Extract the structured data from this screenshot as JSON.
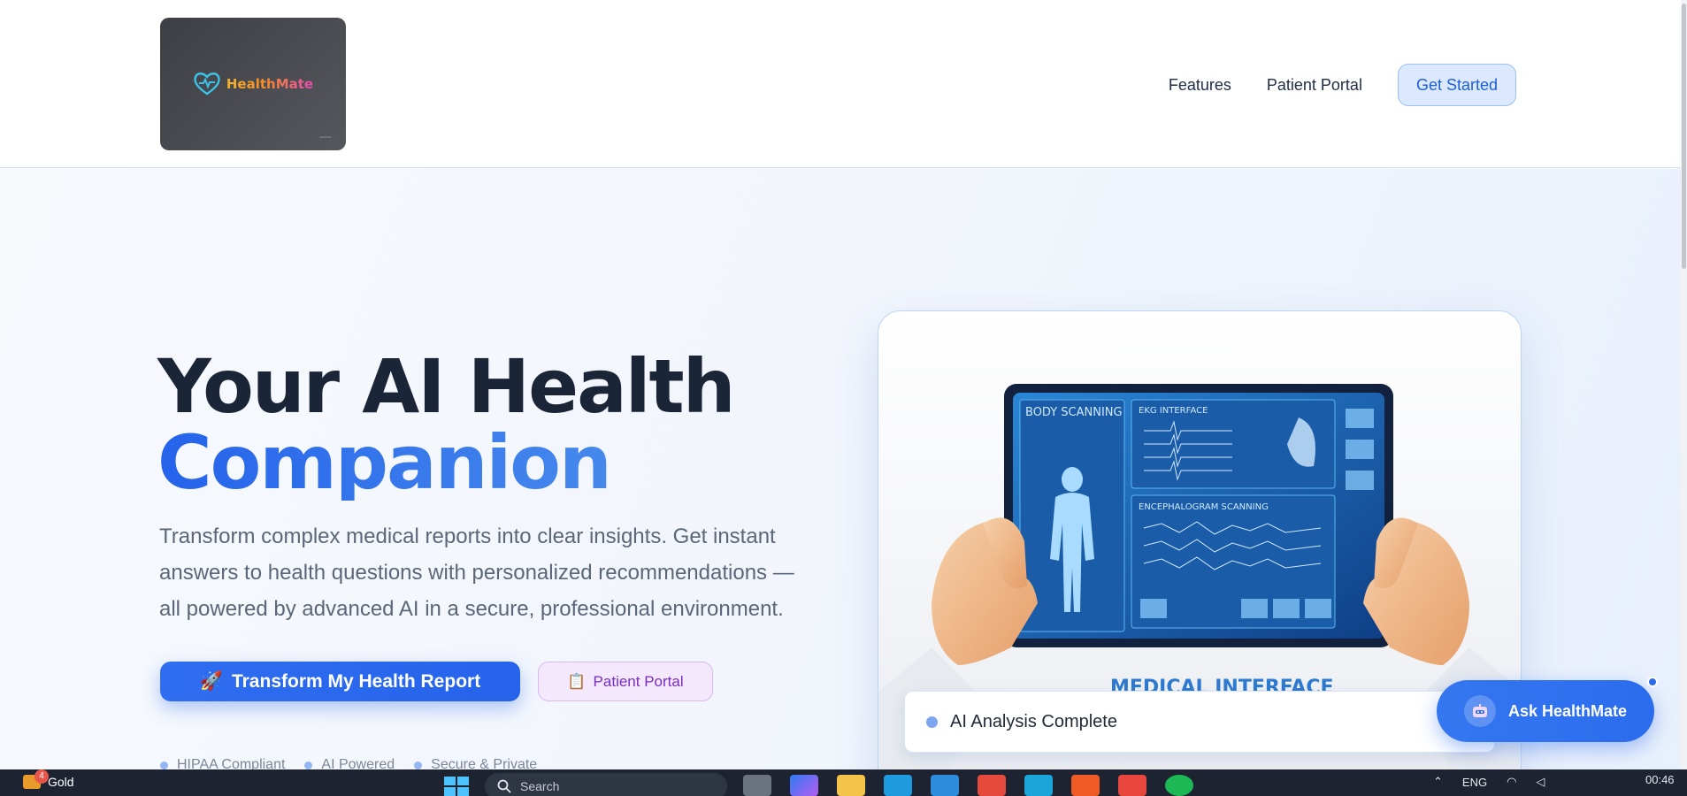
{
  "brand": {
    "name": "HealthMate"
  },
  "nav": {
    "features": "Features",
    "patient_portal": "Patient Portal",
    "get_started": "Get Started"
  },
  "hero": {
    "title_line1": "Your AI Health",
    "title_line2": "Companion",
    "subtitle": "Transform complex medical reports into clear insights. Get instant answers to health questions with personalized recommendations — all powered by advanced AI in a secure, professional environment.",
    "primary_cta": {
      "icon": "🚀",
      "label": "Transform My Health Report"
    },
    "secondary_cta": {
      "icon": "📋",
      "label": "Patient Portal"
    },
    "badges": [
      "HIPAA Compliant",
      "AI Powered",
      "Secure & Private"
    ]
  },
  "image_card": {
    "panel_body": "BODY SCANNING",
    "panel_ekg": "EKG INTERFACE",
    "panel_enc": "ENCEPHALOGRAM SCANNING",
    "caption": "MEDICAL INTERFACE",
    "status_label": "AI Analysis Complete"
  },
  "chat_widget": {
    "label": "Ask HealthMate"
  },
  "taskbar": {
    "weather_badge": "4",
    "weather_label": "Gold",
    "search_placeholder": "Search",
    "language": "ENG",
    "time": "00:46"
  },
  "colors": {
    "primary": "#2563eb",
    "title_dark": "#1b2538",
    "secondary_bg": "#f3e8fc",
    "secondary_text": "#7a2ec2"
  }
}
